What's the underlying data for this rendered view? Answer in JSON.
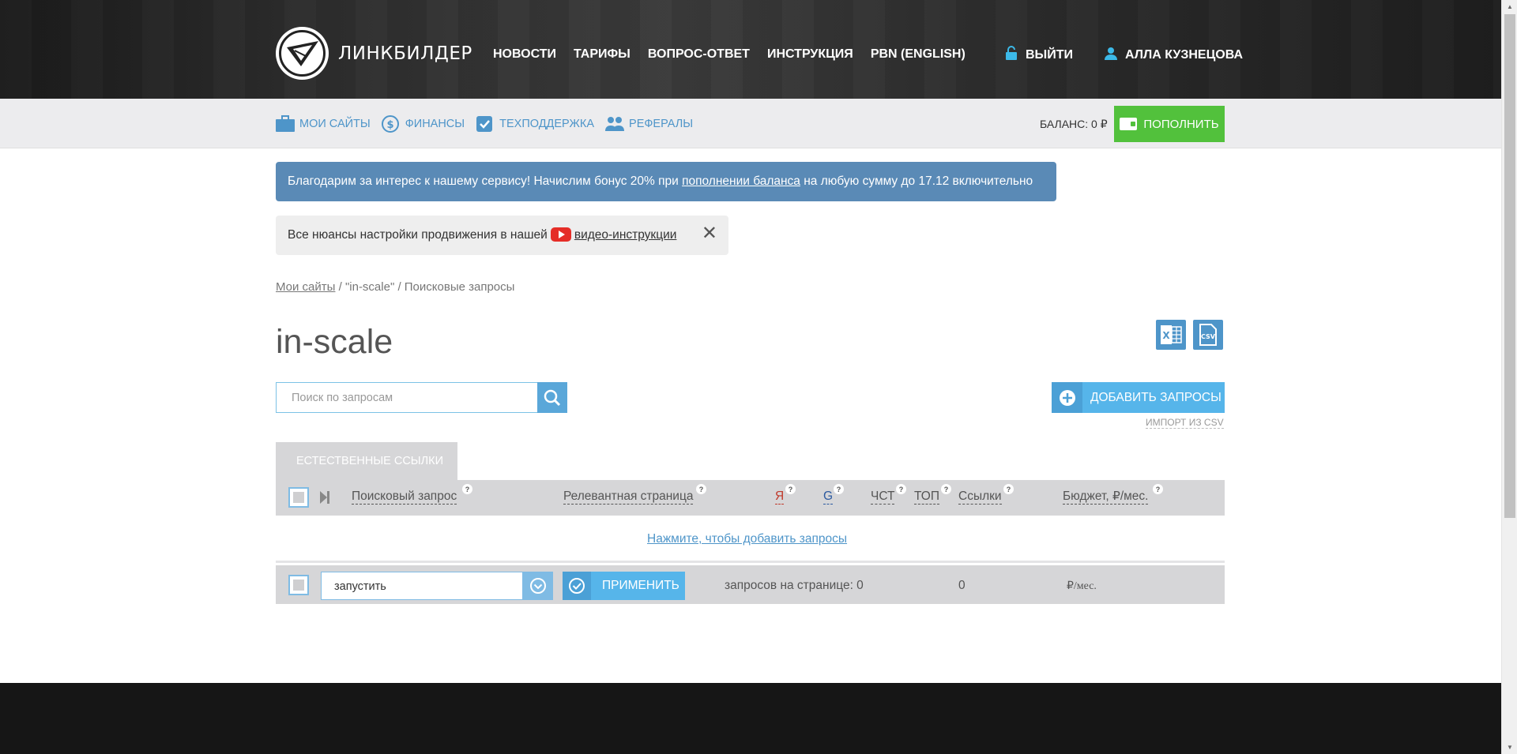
{
  "header": {
    "logo_text": "ЛИНКБИЛДЕР",
    "nav": [
      "НОВОСТИ",
      "ТАРИФЫ",
      "ВОПРОС-ОТВЕТ",
      "ИНСТРУКЦИЯ",
      "PBN (ENGLISH)"
    ],
    "exit_label": "ВЫЙТИ",
    "user_name": "АЛЛА КУЗНЕЦОВА"
  },
  "subnav": {
    "items": [
      "МОИ САЙТЫ",
      "ФИНАНСЫ",
      "ТЕХПОДДЕРЖКА",
      "РЕФЕРАЛЫ"
    ],
    "balance": "БАЛАНС: 0 ₽",
    "topup_label": "ПОПОЛНИТЬ"
  },
  "promo": {
    "before": "Благодарим за интерес к нашему сервису! Начислим бонус 20% при ",
    "link": "пополнении баланса",
    "after": " на любую сумму до 17.12 включительно"
  },
  "video_hint": {
    "text": "Все нюансы настройки продвижения в нашей",
    "link": "видео-инструкции"
  },
  "breadcrumb": {
    "root": "Мои сайты",
    "rest": " / \"in-scale\" / Поисковые запросы"
  },
  "page_title": "in-scale",
  "search": {
    "placeholder": "Поиск по запросам"
  },
  "add_queries_label": "ДОБАВИТЬ ЗАПРОСЫ",
  "import_csv_label": "ИМПОРТ ИЗ CSV",
  "table": {
    "tab_label": "ЕСТЕСТВЕННЫЕ ССЫЛКИ",
    "columns": {
      "query": "Поисковый запрос",
      "page": "Релевантная страница",
      "yandex": "Я",
      "google": "G",
      "freq": "ЧСТ",
      "top": "ТОП",
      "links": "Ссылки",
      "budget": "Бюджет, ₽/мес."
    },
    "help_mark": "?",
    "empty_link": "Нажмите, чтобы добавить запросы",
    "footer": {
      "action_value": "запустить",
      "apply_label": "ПРИМЕНИТЬ",
      "per_page": "запросов на странице: 0",
      "links_total": "0",
      "budget_total": "₽/мес."
    }
  },
  "colors": {
    "accent_blue": "#4e95c9",
    "button_blue": "#56b5ea",
    "green": "#52c13c",
    "promo_bg": "#5a8ab6",
    "yandex_red": "#c0392b",
    "google_blue": "#2c5aa0"
  },
  "icons": [
    "logo-icon",
    "lock-open-icon",
    "user-icon",
    "briefcase-icon",
    "dollar-icon",
    "check-badge-icon",
    "users-icon",
    "wallet-icon",
    "youtube-icon",
    "close-icon",
    "excel-icon",
    "csv-icon",
    "search-icon",
    "plus-circle-icon",
    "skip-end-icon",
    "chevron-down-circle-icon",
    "check-circle-icon"
  ]
}
